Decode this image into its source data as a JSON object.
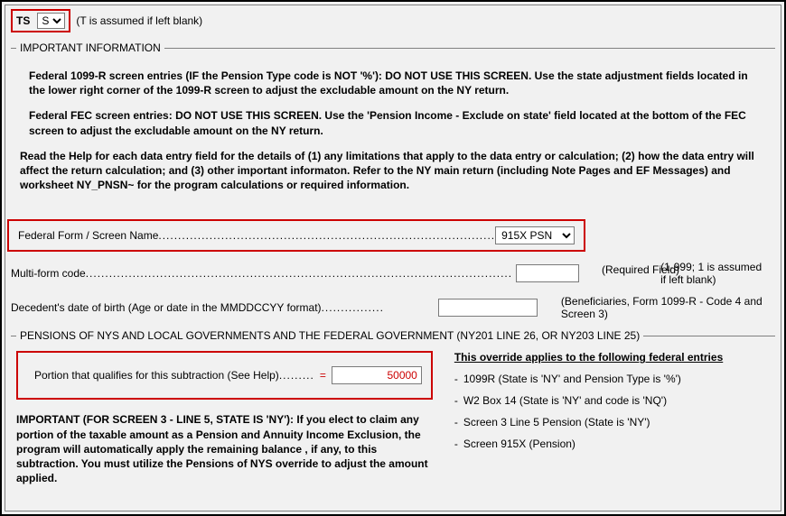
{
  "ts": {
    "label": "TS",
    "value": "S",
    "options": [
      "T",
      "S"
    ],
    "hint": "(T is assumed if left blank)"
  },
  "important": {
    "legend": "IMPORTANT INFORMATION",
    "p1": "Federal 1099-R screen entries (IF the Pension Type code is NOT '%'): DO NOT USE THIS SCREEN. Use the state adjustment fields located  in the lower right corner of the 1099-R screen to adjust the excludable amount on the NY return.",
    "p2": "Federal FEC screen entries: DO NOT USE THIS SCREEN. Use the 'Pension Income - Exclude on state' field located at the bottom of the FEC screen to adjust the excludable amount on the NY return.",
    "p3": "Read the Help for each data entry field for the details of (1) any limitations that apply to the data entry or calculation; (2) how the data entry will affect  the return calculation; and (3) other important informaton.  Refer to the NY main return (including Note Pages and EF Messages) and worksheet NY_PNSN~ for the program calculations or required information."
  },
  "fields": {
    "federal_form": {
      "label": "Federal Form / Screen Name",
      "dots": "......................................................................................",
      "value": "915X PSN",
      "hint": "(Required Field)"
    },
    "multiform": {
      "label": "Multi-form code",
      "dots": ".............................................................................................................",
      "value": "",
      "hint": "(1-999; 1 is assumed if left blank)"
    },
    "decedent": {
      "label": "Decedent's date of birth (Age or date in the MMDDCCYY format)",
      "dots": "................",
      "value": "",
      "hint": "(Beneficiaries, Form 1099-R - Code 4 and Screen 3)"
    }
  },
  "pensions": {
    "legend": "PENSIONS OF NYS AND LOCAL GOVERNMENTS AND THE FEDERAL GOVERNMENT (NY201 LINE 26, OR  NY203 LINE 25)",
    "qualify": {
      "label": "Portion that qualifies for this subtraction (See Help)",
      "dots": ".........",
      "equals": "=",
      "value": "50000"
    },
    "important_note": "IMPORTANT (FOR SCREEN 3 - LINE 5, STATE IS 'NY'):  If you elect to claim any portion of the taxable amount  as  a Pension and Annuity Income Exclusion, the program will automatically apply the remaining balance , if any, to this subtraction.  You must utilize the Pensions of NYS override to adjust the amount applied.",
    "override_heading": "This override applies to the following federal entries",
    "entries": [
      "1099R (State is 'NY' and Pension Type is '%')",
      "W2 Box 14 (State is 'NY' and code is 'NQ')",
      "Screen 3 Line 5 Pension (State is 'NY')",
      "Screen 915X (Pension)"
    ]
  }
}
